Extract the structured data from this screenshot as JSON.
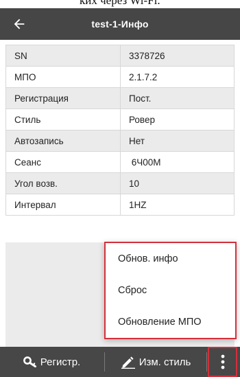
{
  "caption": {
    "fragment": "ких через Wi-Fi."
  },
  "appbar": {
    "title": "test-1-Инфо",
    "back_icon": "arrow-left-icon"
  },
  "info_rows": [
    {
      "key": "SN",
      "value": "3378726"
    },
    {
      "key": "МПО",
      "value": "2.1.7.2"
    },
    {
      "key": "Регистрация",
      "value": "Пост."
    },
    {
      "key": "Стиль",
      "value": "Ровер"
    },
    {
      "key": "Автозапись",
      "value": "Нет"
    },
    {
      "key": "Сеанс",
      "value": " 6Ч00М"
    },
    {
      "key": "Угол возв.",
      "value": "10"
    },
    {
      "key": "Интервал",
      "value": "1HZ"
    }
  ],
  "menu": {
    "items": [
      "Обнов. инфо",
      "Сброс",
      "Обновление МПО"
    ],
    "highlight_color": "#d3303a"
  },
  "bottom_bar": {
    "register_label": "Регистр.",
    "register_icon": "key-icon",
    "edit_style_label": "Изм. стиль",
    "edit_style_icon": "pen-icon",
    "more_icon": "more-vertical-icon"
  },
  "colors": {
    "appbar": "#464646",
    "row_shaded": "#ebebeb",
    "row_plain": "#ffffff",
    "accent_red": "#d3303a"
  }
}
